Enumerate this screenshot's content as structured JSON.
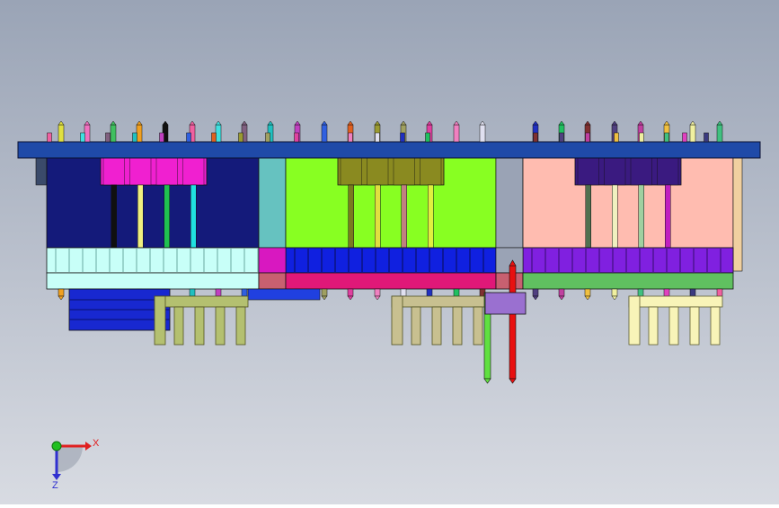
{
  "viewport": {
    "background_top": "#9aa4b6",
    "background_bottom": "#d8dbe2"
  },
  "triad": {
    "x_label": "X",
    "z_label": "Z",
    "x_color": "#e02020",
    "z_color": "#3030d0",
    "origin_color": "#20c020"
  },
  "colors": {
    "top_plate": "#1f4aa8",
    "navy_block": "#141a7a",
    "teal_block": "#66c2c0",
    "green_block": "#88ff22",
    "pink_block": "#ffbcb0",
    "cyan_base": "#c8fff8",
    "blue_base": "#1020e0",
    "purple_base": "#8020e0",
    "magenta_strip": "#e01878",
    "green_strip": "#60c060",
    "rose_strip": "#c86070",
    "magenta_group": "#f020d0",
    "olive_group": "#8a8a20",
    "indigo_group": "#3a1a80",
    "olive_header": "#b4c070",
    "tan_header": "#c8c090",
    "cream_header": "#f8f4b8",
    "blue_stack": "#1828d0",
    "lavender_box": "#9a70d0"
  }
}
